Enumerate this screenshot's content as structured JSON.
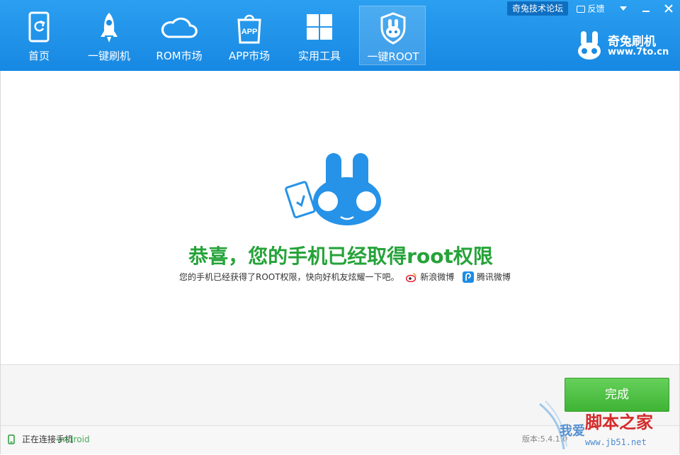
{
  "header": {
    "nav": [
      {
        "label": "首页",
        "icon": "phone-refresh-icon"
      },
      {
        "label": "一键刷机",
        "icon": "rocket-icon"
      },
      {
        "label": "ROM市场",
        "icon": "cloud-icon"
      },
      {
        "label": "APP市场",
        "icon": "app-bag-icon"
      },
      {
        "label": "实用工具",
        "icon": "windows-grid-icon"
      },
      {
        "label": "一键ROOT",
        "icon": "rabbit-shield-icon",
        "active": true
      }
    ],
    "forum_label": "奇兔技术论坛",
    "feedback_label": "反馈",
    "brand": {
      "name": "奇兔刷机",
      "url": "www.7to.cn"
    }
  },
  "main": {
    "title": "恭喜，您的手机已经取得root权限",
    "subtitle": "您的手机已经获得了ROOT权限，快向好机友炫耀一下吧。",
    "share": [
      {
        "label": "新浪微博",
        "icon": "weibo-icon"
      },
      {
        "label": "腾讯微博",
        "icon": "tencent-weibo-icon"
      }
    ]
  },
  "footer": {
    "done_label": "完成"
  },
  "status": {
    "text": "正在连接手机",
    "overlay_text": "android",
    "version": "版本:5.4.1.0"
  },
  "watermark": {
    "site": "脚本之家",
    "url": "www.jb51.net",
    "text": "我爱"
  },
  "colors": {
    "header": "#1b8ce6",
    "success": "#25a339",
    "button": "#4cbf41",
    "brand_blue": "#2693e8"
  }
}
